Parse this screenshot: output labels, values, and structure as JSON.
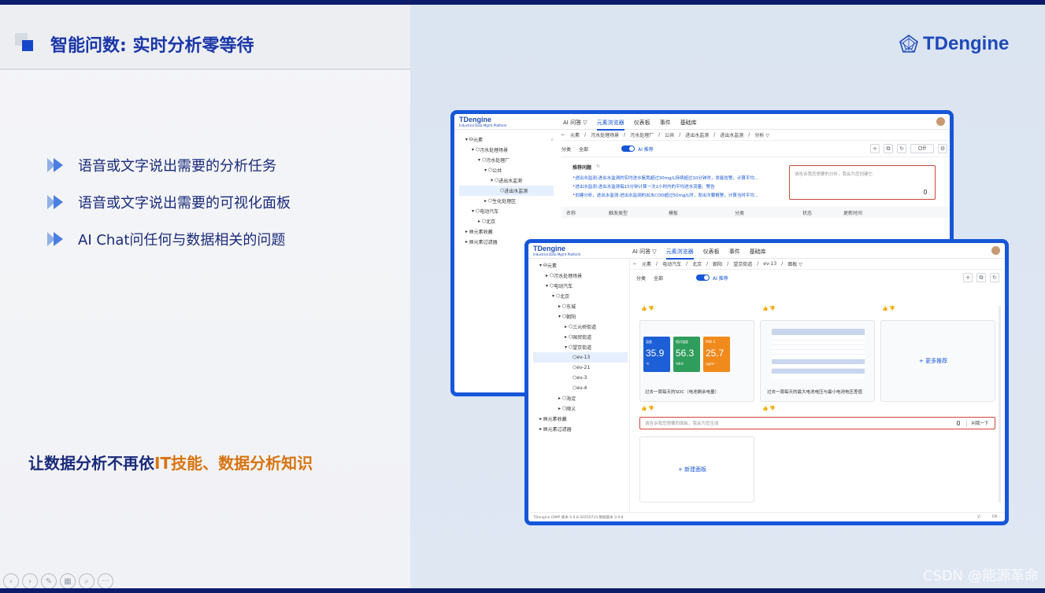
{
  "slide": {
    "title": "智能问数: 实时分析零等待",
    "brand": "TDengine",
    "bullets": [
      "语音或文字说出需要的分析任务",
      "语音或文字说出需要的可视化面板",
      "AI Chat问任何与数据相关的问题"
    ],
    "tagline_prefix": "让数据分析不再依",
    "tagline_highlight": "IT技能、数据分析知识",
    "watermark": "CSDN @能源革命"
  },
  "colors": {
    "brand_blue": "#1656d8",
    "title_blue": "#1a36a8",
    "tagline_orange": "#d77410",
    "alert_red": "#d4453a"
  },
  "app1": {
    "logo_name": "TDengine",
    "logo_sub": "Industrial Data Mgmt Platform",
    "nav": [
      "AI 问答 ▽",
      "元素浏览器",
      "仪表板",
      "事件",
      "基础库"
    ],
    "tree": [
      "元素",
      "污水处理场景",
      "污水处理厂",
      "公共",
      "进出水监测",
      "进出水监测",
      "生化处理区",
      "电动汽车",
      "北京",
      "元素收藏",
      "元素过滤器"
    ],
    "breadcrumb": [
      "元素",
      "污水处理场景",
      "污水处理厂",
      "公共",
      "进出水监测",
      "进出水监测",
      "分析 ▽"
    ],
    "filter_label": "分类",
    "filter_value": "全部",
    "ai_toggle_label": "AI 推荐",
    "off_select": "Off",
    "questions_title": "推荐问题",
    "questions": [
      "进出水监测:进出水监测的实时进水氨氮超过30mg/L持续超过10分钟时，发能告警，计算平均...",
      "进出水监测:进出水监测每15分钟计算一次1小时内的平均进水流量。警告",
      "创建分析，进出水监测:进出水监测的出水COD超过50mg/L时，发出次要报警，计算当时平均..."
    ],
    "ai_placeholder": "请告诉我您想要的分析，我会为您创建它",
    "table_headers": [
      "名称",
      "触发类型",
      "模板",
      "分类",
      "状态",
      "更新时间"
    ]
  },
  "app2": {
    "logo_name": "TDengine",
    "logo_sub": "Industrial Data Mgmt Platform",
    "nav": [
      "AI 问答 ▽",
      "元素浏览器",
      "仪表板",
      "事件",
      "基础库"
    ],
    "tree": [
      "元素",
      "污水处理场景",
      "电动汽车",
      "北京",
      "东城",
      "朝阳",
      "三元桥街道",
      "国贸街道",
      "望京街道",
      "ev-13",
      "ev-21",
      "ev-3",
      "ev-4",
      "海淀",
      "顺义",
      "元素收藏",
      "元素过滤器"
    ],
    "breadcrumb": [
      "元素",
      "电动汽车",
      "北京",
      "朝阳",
      "望京街道",
      "ev-13",
      "面板 ▽"
    ],
    "filter_label": "分类",
    "filter_value": "全部",
    "ai_toggle_label": "AI 推荐",
    "metrics": [
      {
        "label": "温度",
        "value": "35.9",
        "unit": "℃",
        "color": "#1c5fd6"
      },
      {
        "label": "相对湿度",
        "value": "56.3",
        "unit": "%RH",
        "color": "#2f9d5b"
      },
      {
        "label": "PM2.5",
        "value": "25.7",
        "unit": "ug/m³",
        "color": "#f08a1c"
      }
    ],
    "card1_caption": "过去一周每天的SOC（电池剩余电量）",
    "card2_caption": "过去一周每天的最大电池电压与最小电池电压差值",
    "more_label": "+ 更多推荐",
    "ask_placeholder": "请告诉我您想要的面板，我会为您生成",
    "ask_button": "问我一下",
    "new_panel_label": "+ 新建面板",
    "footer_text": "TDengine IDMP 版本 0.9.8-20250724 数据版本 0.9.8",
    "footer_lang": "EN"
  }
}
